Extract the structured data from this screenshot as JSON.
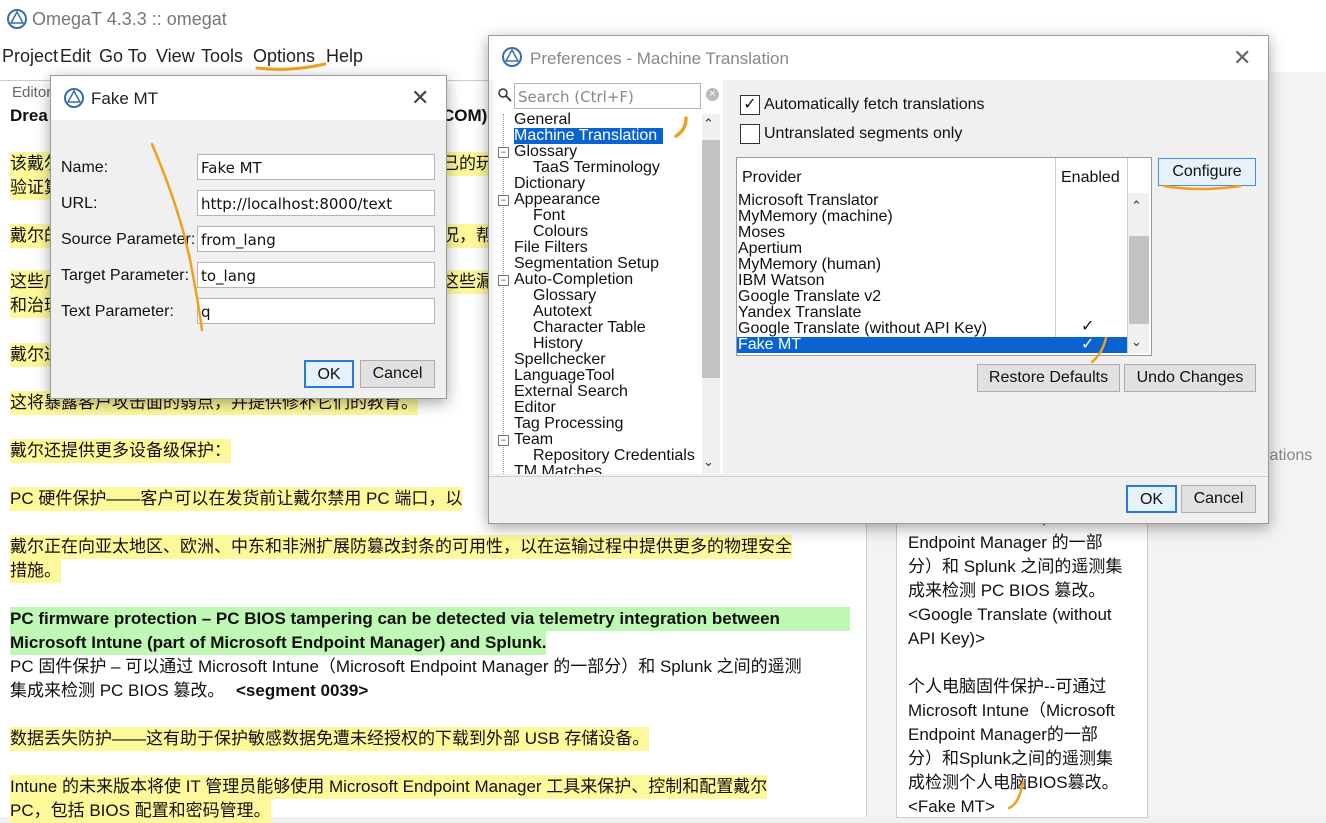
{
  "app": {
    "title": "OmegaT 4.3.3 :: omegat"
  },
  "menu": [
    "Project",
    "Edit",
    "Go To",
    "View",
    "Tools",
    "Options",
    "Help"
  ],
  "editor": {
    "tab": "Editor",
    "segments": [
      "Drea",
      "该戴尔",
      "验证算",
      "戴尔的",
      "这些广",
      "和治理",
      "戴尔通",
      "这将暴露客户攻击面的弱点，并提供修补它们的教育。",
      "戴尔还提供更多设备级保护：",
      "PC 硬件保护——客户可以在发货前让戴尔禁用 PC 端口，以",
      "戴尔正在向亚太地区、欧洲、中东和非洲扩展防篡改封条的可用性，以在运输过程中提供更多的物理安全",
      "措施。",
      "PC firmware protection – PC BIOS tampering can be detected via telemetry integration between",
      "Microsoft Intune (part of Microsoft Endpoint Manager) and Splunk.",
      "PC 固件保护 – 可以通过 Microsoft Intune（Microsoft Endpoint Manager 的一部分）和 Splunk 之间的遥测",
      "集成来检测 PC BIOS 篡改。",
      "<segment 0039>",
      "数据丢失防护——这有助于保护敏感数据免遭未经授权的下载到外部 USB 存储设备。",
      "Intune 的未来版本将使 IT 管理员能够使用 Microsoft Endpoint Manager 工具来保护、控制和配置戴尔",
      "PC，包括 BIOS 配置和密码管理。"
    ],
    "partial_right": [
      "COM)",
      "已的玩",
      "况，帮",
      "这些漏"
    ]
  },
  "mt_pane": {
    "side_label": "lations",
    "lines": [
      "Microsoft Intune（Microsoft",
      "Endpoint Manager 的一部",
      "分）和 Splunk 之间的遥测集",
      "成来检测 PC BIOS 篡改。",
      "<Google Translate (without",
      "API Key)>",
      "",
      "个人电脑固件保护--可通过",
      "Microsoft Intune（Microsoft",
      "Endpoint Manager的一部",
      "分）和Splunk之间的遥测集",
      "成检测个人电脑BIOS篡改。",
      "<Fake MT>"
    ]
  },
  "fake_mt": {
    "title": "Fake MT",
    "fields": [
      {
        "label": "Name:",
        "value": "Fake MT"
      },
      {
        "label": "URL:",
        "value": "http://localhost:8000/text"
      },
      {
        "label": "Source Parameter:",
        "value": "from_lang"
      },
      {
        "label": "Target Parameter:",
        "value": "to_lang"
      },
      {
        "label": "Text Parameter:",
        "value": "q"
      }
    ],
    "ok": "OK",
    "cancel": "Cancel"
  },
  "prefs": {
    "title": "Preferences - Machine Translation",
    "search_placeholder": "Search (Ctrl+F)",
    "tree": [
      "General",
      "Machine Translation",
      "Glossary",
      "TaaS Terminology",
      "Dictionary",
      "Appearance",
      "Font",
      "Colours",
      "File Filters",
      "Segmentation Setup",
      "Auto-Completion",
      "Glossary",
      "Autotext",
      "Character Table",
      "History",
      "Spellchecker",
      "LanguageTool",
      "External Search",
      "Editor",
      "Tag Processing",
      "Team",
      "Repository Credentials",
      "TM Matches"
    ],
    "auto_fetch": "Automatically fetch translations",
    "untranslated_only": "Untranslated segments only",
    "col_provider": "Provider",
    "col_enabled": "Enabled",
    "providers": [
      {
        "name": "Microsoft Translator",
        "enabled": false
      },
      {
        "name": "MyMemory (machine)",
        "enabled": false
      },
      {
        "name": "Moses",
        "enabled": false
      },
      {
        "name": "Apertium",
        "enabled": false
      },
      {
        "name": "MyMemory (human)",
        "enabled": false
      },
      {
        "name": "IBM Watson",
        "enabled": false
      },
      {
        "name": "Google Translate v2",
        "enabled": false
      },
      {
        "name": "Yandex Translate",
        "enabled": false
      },
      {
        "name": "Google Translate (without API Key)",
        "enabled": true
      },
      {
        "name": "Fake MT",
        "enabled": true
      }
    ],
    "configure": "Configure",
    "restore": "Restore Defaults",
    "undo": "Undo Changes",
    "ok": "OK",
    "cancel": "Cancel",
    "check_mark": "✓"
  },
  "colors": {
    "selection": "#0a64d0",
    "highlight": "#fdf89a",
    "annotation": "#f0a020"
  }
}
